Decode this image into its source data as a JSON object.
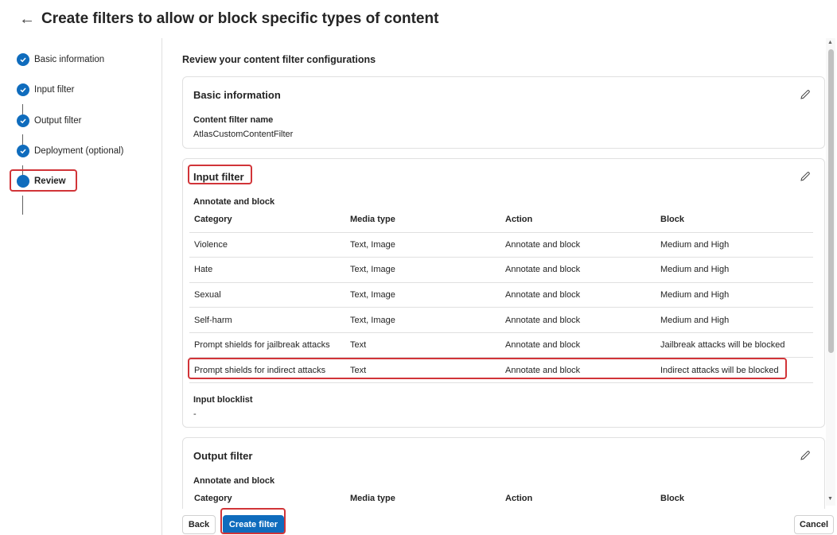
{
  "header": {
    "title": "Create filters to allow or block specific types of content"
  },
  "steps": [
    {
      "label": "Basic information"
    },
    {
      "label": "Input filter"
    },
    {
      "label": "Output filter"
    },
    {
      "label": "Deployment (optional)"
    },
    {
      "label": "Review"
    }
  ],
  "main": {
    "section_title": "Review your content filter configurations",
    "basic_info": {
      "title": "Basic information",
      "name_label": "Content filter name",
      "name_value": "AtlasCustomContentFilter"
    },
    "input_filter": {
      "title": "Input filter",
      "subheading": "Annotate and block",
      "columns": [
        "Category",
        "Media type",
        "Action",
        "Block"
      ],
      "rows": [
        [
          "Violence",
          "Text, Image",
          "Annotate and block",
          "Medium and High"
        ],
        [
          "Hate",
          "Text, Image",
          "Annotate and block",
          "Medium and High"
        ],
        [
          "Sexual",
          "Text, Image",
          "Annotate and block",
          "Medium and High"
        ],
        [
          "Self-harm",
          "Text, Image",
          "Annotate and block",
          "Medium and High"
        ],
        [
          "Prompt shields for jailbreak attacks",
          "Text",
          "Annotate and block",
          "Jailbreak attacks will be blocked"
        ],
        [
          "Prompt shields for indirect attacks",
          "Text",
          "Annotate and block",
          "Indirect attacks will be blocked"
        ]
      ],
      "blocklist_label": "Input blocklist",
      "blocklist_value": "-"
    },
    "output_filter": {
      "title": "Output filter",
      "subheading": "Annotate and block",
      "columns": [
        "Category",
        "Media type",
        "Action",
        "Block"
      ]
    }
  },
  "footer": {
    "back_label": "Back",
    "create_label": "Create filter",
    "cancel_label": "Cancel"
  },
  "colors": {
    "accent": "#0f6cbd",
    "highlight": "#d13438"
  }
}
